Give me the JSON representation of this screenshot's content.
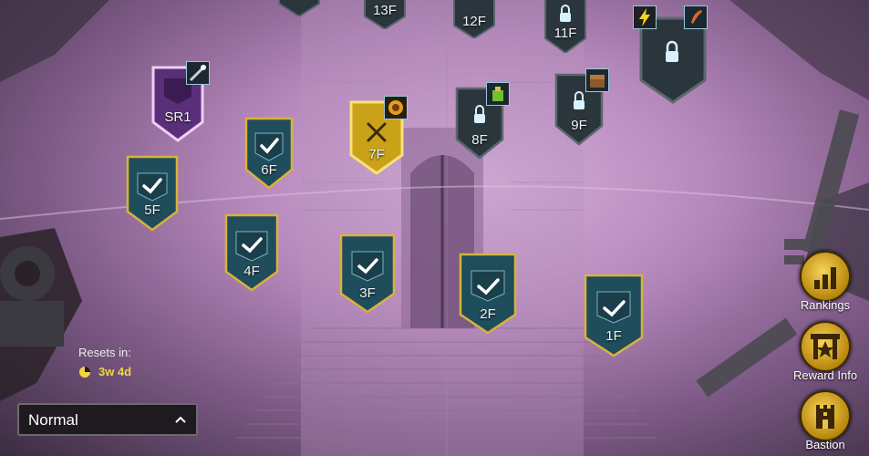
{
  "floors": {
    "sr1": {
      "label": "SR1"
    },
    "f1": {
      "label": "1F"
    },
    "f2": {
      "label": "2F"
    },
    "f3": {
      "label": "3F"
    },
    "f4": {
      "label": "4F"
    },
    "f5": {
      "label": "5F"
    },
    "f6": {
      "label": "6F"
    },
    "f7": {
      "label": "7F"
    },
    "f8": {
      "label": "8F"
    },
    "f9": {
      "label": "9F"
    },
    "f11": {
      "label": "11F"
    },
    "f12": {
      "label": "12F"
    },
    "f13": {
      "label": "13F"
    }
  },
  "side_buttons": {
    "rankings": "Rankings",
    "reward_info": "Reward Info",
    "bastion": "Bastion"
  },
  "reset": {
    "label": "Resets in:",
    "time": "3w 4d"
  },
  "difficulty": {
    "selected": "Normal"
  },
  "colors": {
    "completed": "#1f4d5c",
    "gold_border": "#d9b23a",
    "current": "#c9a21a",
    "locked": "#2a353c",
    "special": "#5a2f7a",
    "accent": "#f5d43c"
  }
}
